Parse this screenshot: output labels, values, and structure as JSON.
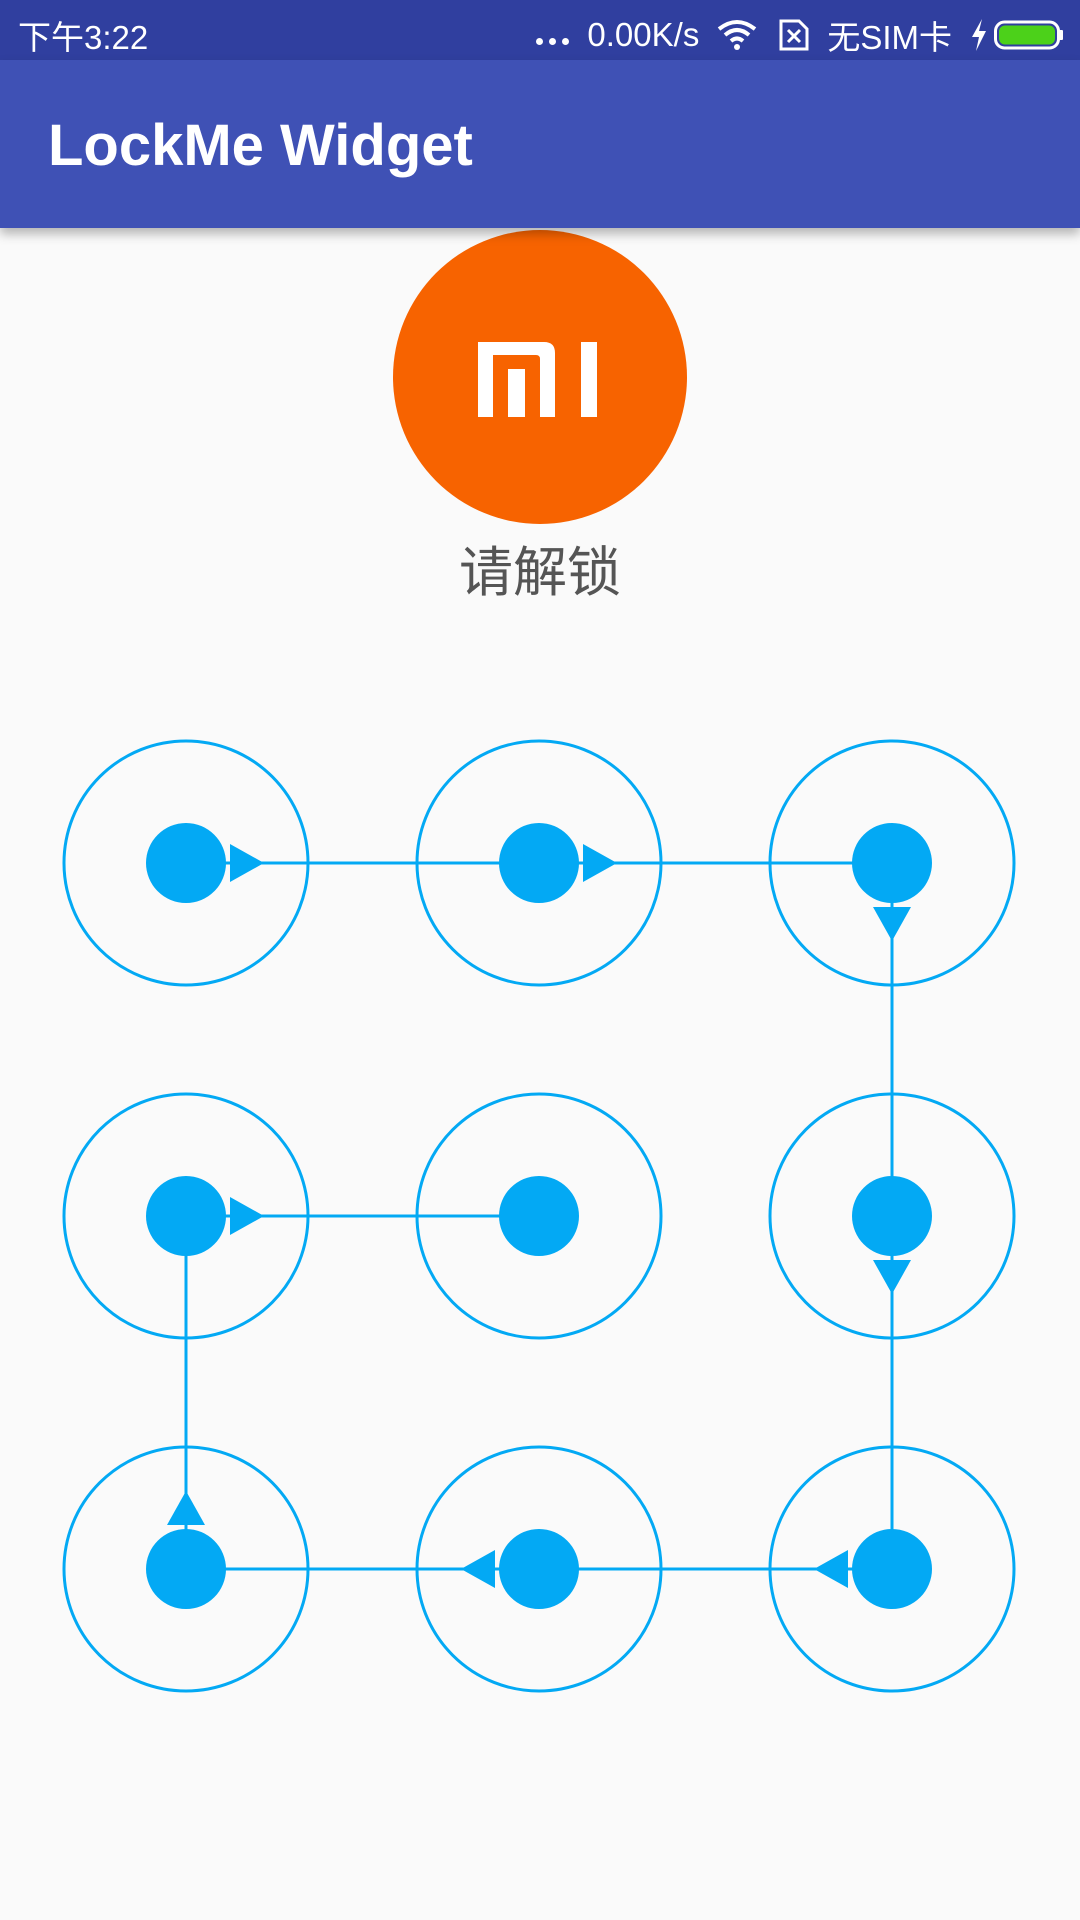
{
  "status_bar": {
    "time": "下午3:22",
    "net_speed": "0.00K/s",
    "sim_text": "无SIM卡",
    "icons": [
      "more-dots-icon",
      "wifi-icon",
      "sim-error-icon",
      "charging-icon",
      "battery-icon"
    ]
  },
  "app_bar": {
    "title": "LockMe Widget"
  },
  "avatar": {
    "logo": "mi-logo-icon",
    "bg_color": "#f76300"
  },
  "prompt": "请解锁",
  "pattern": {
    "color": "#03a9f4",
    "grid": [
      [
        1,
        2,
        3
      ],
      [
        4,
        5,
        6
      ],
      [
        7,
        8,
        9
      ]
    ],
    "selected_sequence": [
      1,
      2,
      3,
      6,
      9,
      8,
      7,
      4,
      5
    ]
  }
}
